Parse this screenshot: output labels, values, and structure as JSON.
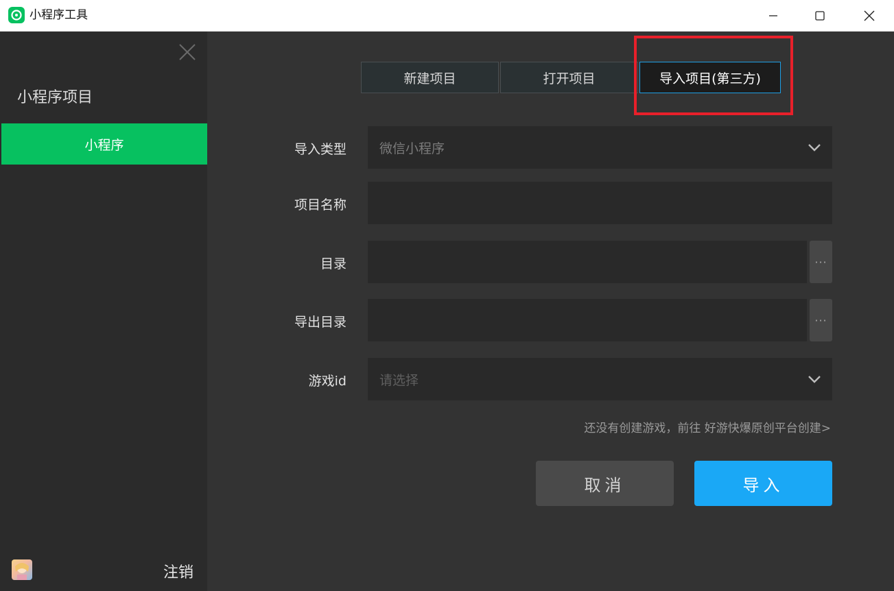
{
  "window": {
    "title": "小程序工具",
    "app_icon": "miniprogram-logo-icon",
    "controls": [
      "minimize-icon",
      "maximize-icon",
      "close-icon"
    ]
  },
  "sidebar": {
    "heading": "小程序项目",
    "items": [
      {
        "label": "小程序",
        "active": true
      }
    ],
    "logout_label": "注销",
    "accent_color": "#07c160"
  },
  "tabs": [
    {
      "label": "新建项目",
      "active": false
    },
    {
      "label": "打开项目",
      "active": false
    },
    {
      "label": "导入项目(第三方)",
      "active": true
    }
  ],
  "form": {
    "import_type": {
      "label": "导入类型",
      "value": "微信小程序"
    },
    "project_name": {
      "label": "项目名称",
      "value": ""
    },
    "directory": {
      "label": "目录",
      "value": "",
      "browse_label": "···"
    },
    "export_directory": {
      "label": "导出目录",
      "value": "",
      "browse_label": "···"
    },
    "game_id": {
      "label": "游戏id",
      "placeholder": "请选择"
    }
  },
  "hint_text": "还没有创建游戏，前往 好游快爆原创平台创建>",
  "buttons": {
    "cancel": "取消",
    "import": "导入"
  },
  "colors": {
    "import_button": "#1aa8f6",
    "active_tab_border": "#1ea0e6",
    "highlight": "#e8202a"
  }
}
